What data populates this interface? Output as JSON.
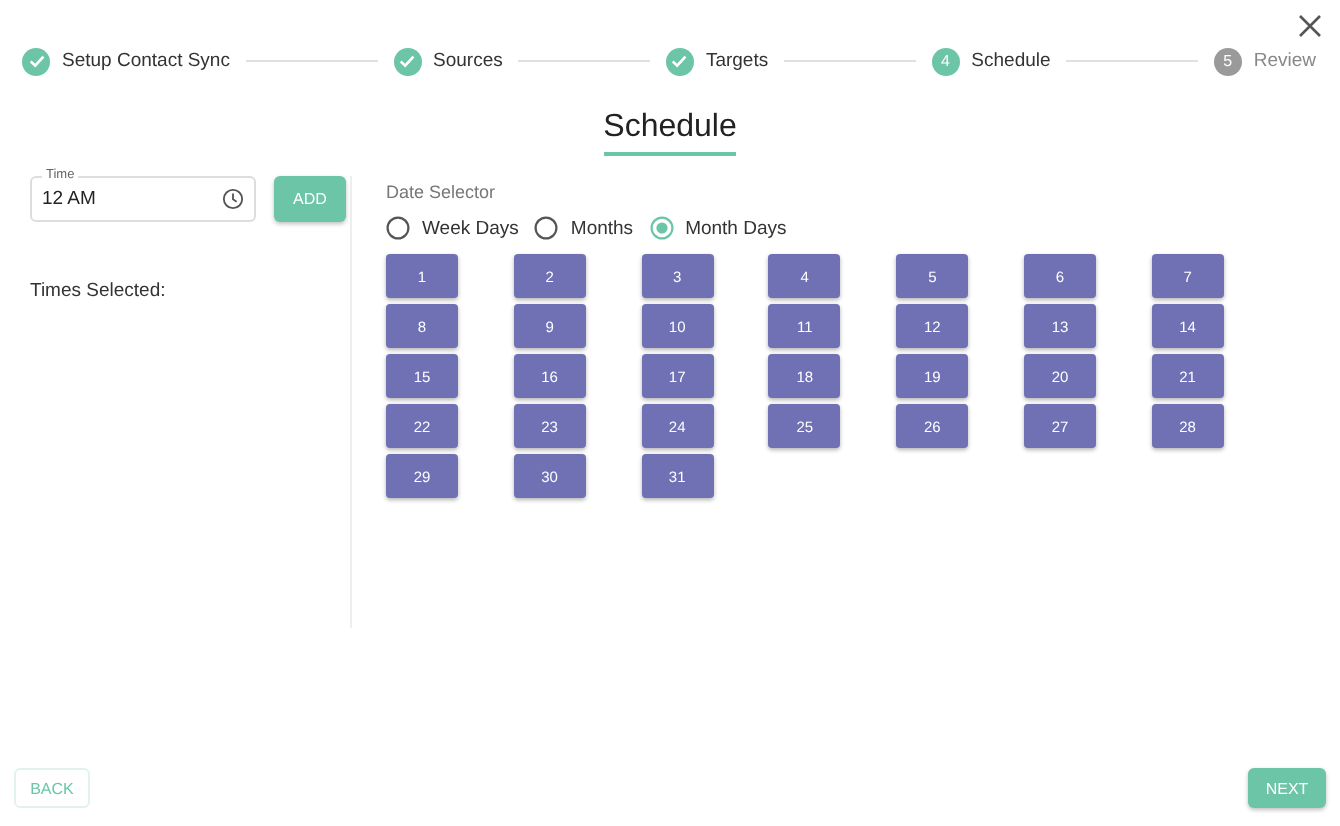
{
  "steps": [
    {
      "label": "Setup Contact Sync",
      "kind": "done"
    },
    {
      "label": "Sources",
      "kind": "done"
    },
    {
      "label": "Targets",
      "kind": "done"
    },
    {
      "label": "Schedule",
      "kind": "active",
      "number": "4"
    },
    {
      "label": "Review",
      "kind": "pending",
      "number": "5"
    }
  ],
  "title": "Schedule",
  "time_field": {
    "label": "Time",
    "value": "12 AM"
  },
  "add_button": "ADD",
  "times_selected_label": "Times Selected:",
  "date_selector": {
    "label": "Date Selector",
    "options": [
      {
        "label": "Week Days",
        "selected": false
      },
      {
        "label": "Months",
        "selected": false
      },
      {
        "label": "Month Days",
        "selected": true
      }
    ],
    "days": [
      "1",
      "2",
      "3",
      "4",
      "5",
      "6",
      "7",
      "8",
      "9",
      "10",
      "11",
      "12",
      "13",
      "14",
      "15",
      "16",
      "17",
      "18",
      "19",
      "20",
      "21",
      "22",
      "23",
      "24",
      "25",
      "26",
      "27",
      "28",
      "29",
      "30",
      "31"
    ]
  },
  "back_button": "BACK",
  "next_button": "NEXT"
}
